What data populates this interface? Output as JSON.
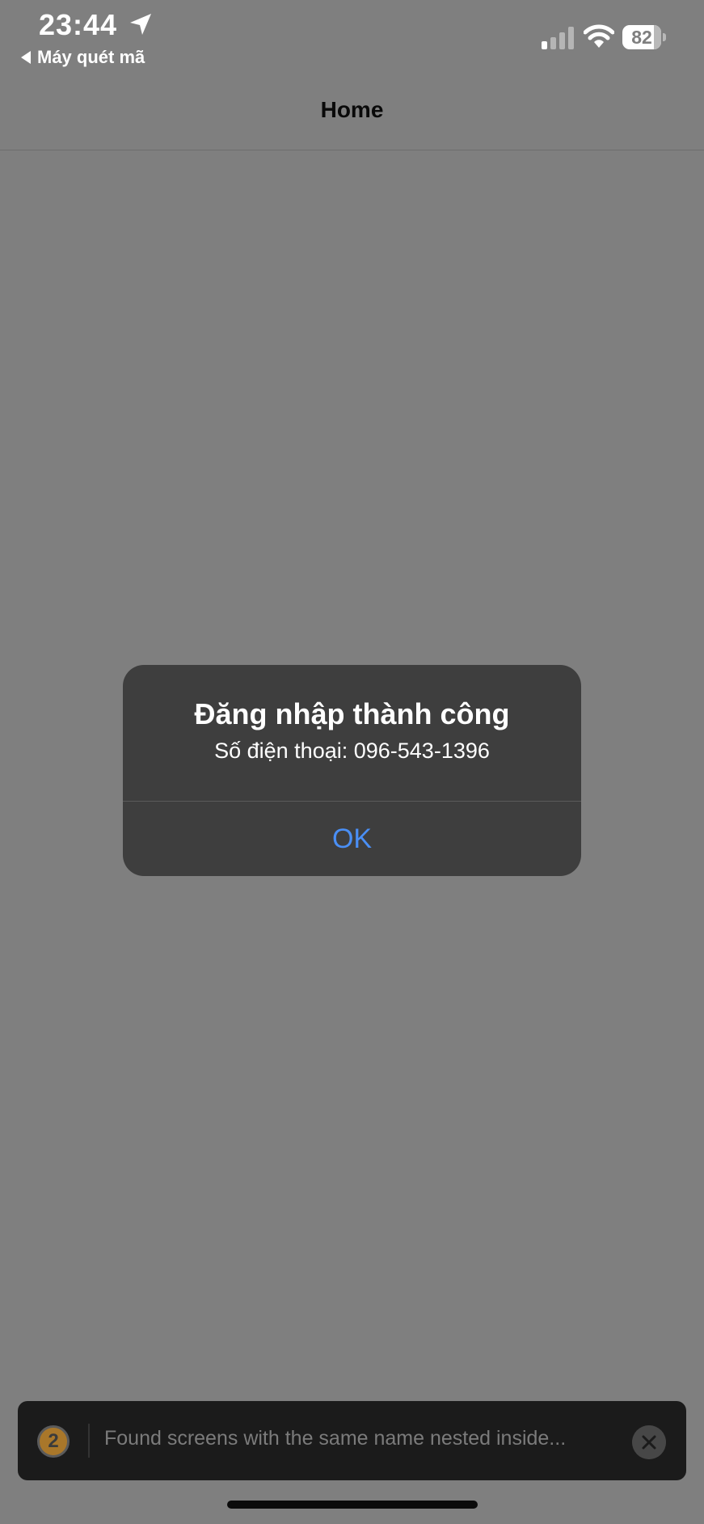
{
  "status_bar": {
    "time": "23:44",
    "back_app_label": "Máy quét mã",
    "battery_level": "82",
    "icons": [
      "location-arrow-icon",
      "cellular-signal-icon",
      "wifi-icon",
      "battery-icon"
    ]
  },
  "nav": {
    "title": "Home"
  },
  "alert": {
    "title": "Đăng nhập thành công",
    "message": "Số điện thoại: 096-543-1396",
    "ok_label": "OK"
  },
  "toast": {
    "count": "2",
    "message": "Found screens with the same name nested inside...",
    "close_icon": "close-icon"
  },
  "colors": {
    "backdrop": "#7f7f7f",
    "alert_background": "#3e3e3e",
    "accent_blue": "#4a8ff5",
    "toast_background": "#1b1b1b",
    "badge_orange": "#a9772a"
  }
}
